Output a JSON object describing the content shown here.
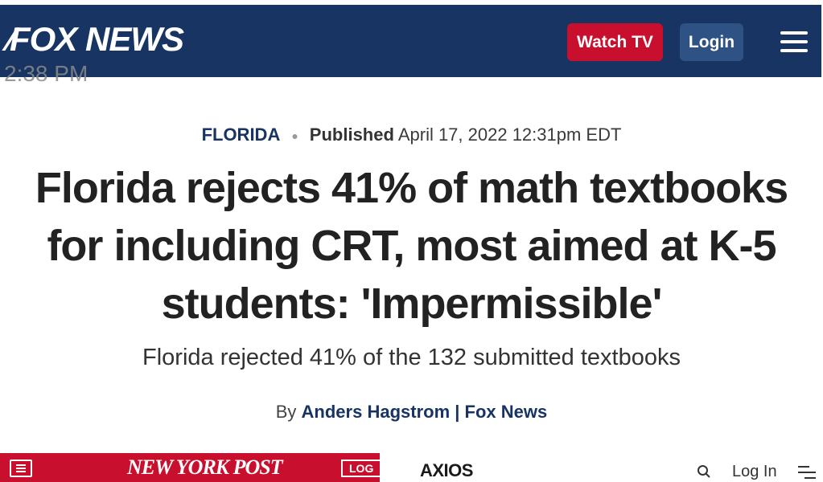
{
  "header": {
    "logo": "FOX NEWS",
    "status_time": "2:38 PM",
    "watch_tv_label": "Watch TV",
    "login_label": "Login",
    "brand_color": "#173462",
    "watch_color": "#c8102e"
  },
  "article": {
    "section": "FLORIDA",
    "published_label": "Published",
    "published_date": "April 17, 2022 12:31pm EDT",
    "headline": "Florida rejects 41% of math textbooks for including CRT, most aimed at K-5 students: 'Impermissible'",
    "subhead": "Florida rejected 41% of the 132 submitted textbooks",
    "byline_prefix": "By",
    "author": "Anders Hagstrom",
    "byline_separator": "|",
    "outlet": "Fox News"
  },
  "bottom_left": {
    "logo": "NEW YORK POST",
    "login_label": "LOG"
  },
  "bottom_right": {
    "logo": "AXIOS",
    "login_label": "Log In"
  }
}
